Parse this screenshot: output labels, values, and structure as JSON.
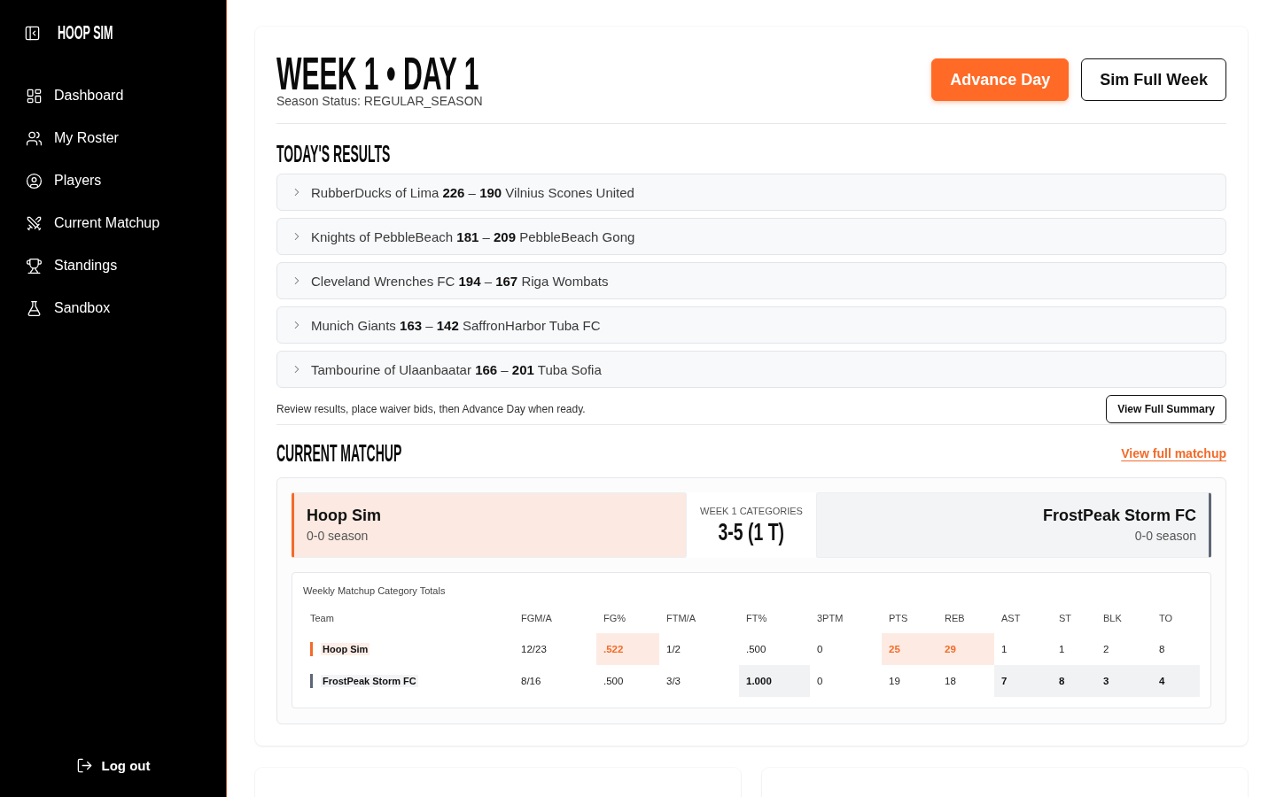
{
  "sidebar": {
    "logo": "HOOP SIM",
    "items": [
      {
        "label": "Dashboard"
      },
      {
        "label": "My Roster"
      },
      {
        "label": "Players"
      },
      {
        "label": "Current Matchup"
      },
      {
        "label": "Standings"
      },
      {
        "label": "Sandbox"
      }
    ],
    "logout": "Log out"
  },
  "header": {
    "title": "WEEK 1 • DAY 1",
    "status": "Season Status: REGULAR_SEASON",
    "buttons": [
      {
        "label": "Advance Day",
        "kind": "primary"
      },
      {
        "label": "Sim Full Week",
        "kind": "outline"
      }
    ]
  },
  "results": {
    "title": "TODAY'S RESULTS",
    "games": [
      {
        "text": "RubberDucks of Lima **226** – **190** Vilnius Scones United",
        "expanded": false
      },
      {
        "text": "Knights of PebbleBeach **181** – **209** PebbleBeach Gong",
        "expanded": false
      },
      {
        "text": "Cleveland Wrenches FC **194** – **167** Riga Wombats",
        "expanded": false
      },
      {
        "text": "Munich Giants **163** – **142** SaffronHarbor Tuba FC",
        "expanded": false
      },
      {
        "text": "Tambourine of Ulaanbaatar **166** – **201** Tuba Sofia",
        "expanded": false
      }
    ],
    "note": "Review results, place waiver bids, then Advance Day when ready.",
    "summary_button": "View Full Summary"
  },
  "matchup": {
    "title": "CURRENT MATCHUP",
    "link": "View full matchup",
    "teams": [
      {
        "name": "Hoop Sim",
        "record": "0-0 season",
        "kind": "home"
      },
      {
        "name": "FrostPeak Storm FC",
        "record": "0-0 season",
        "kind": "away"
      }
    ],
    "categories_label": "WEEK 1 CATEGORIES",
    "categories_score": "3-5 (1 T)",
    "table": {
      "title": "Weekly Matchup Category Totals",
      "columns": [
        "Team",
        "FGM/A",
        "FG%",
        "FTM/A",
        "FT%",
        "3PTM",
        "PTS",
        "REB",
        "AST",
        "ST",
        "BLK",
        "TO"
      ],
      "rows": [
        {
          "kind": "home",
          "color": "#f26b2a",
          "cells": [
            {
              "value": "Hoop Sim"
            },
            {
              "value": "12/23",
              "winner": false
            },
            {
              "value": ".522",
              "winner": true
            },
            {
              "value": "1/2",
              "winner": false
            },
            {
              "value": ".500",
              "winner": false
            },
            {
              "value": "0",
              "winner": false
            },
            {
              "value": "25",
              "winner": true
            },
            {
              "value": "29",
              "winner": true
            },
            {
              "value": "1",
              "winner": false
            },
            {
              "value": "1",
              "winner": false
            },
            {
              "value": "2",
              "winner": false
            },
            {
              "value": "8",
              "winner": false
            }
          ]
        },
        {
          "kind": "away",
          "color": "#5f6675",
          "cells": [
            {
              "value": "FrostPeak Storm FC"
            },
            {
              "value": "8/16",
              "winner": false
            },
            {
              "value": ".500",
              "winner": false
            },
            {
              "value": "3/3",
              "winner": false
            },
            {
              "value": "1.000",
              "winner": true
            },
            {
              "value": "0",
              "winner": false
            },
            {
              "value": "19",
              "winner": false
            },
            {
              "value": "18",
              "winner": false
            },
            {
              "value": "7",
              "winner": true
            },
            {
              "value": "8",
              "winner": true
            },
            {
              "value": "3",
              "winner": true
            },
            {
              "value": "4",
              "winner": true
            }
          ]
        }
      ]
    }
  }
}
